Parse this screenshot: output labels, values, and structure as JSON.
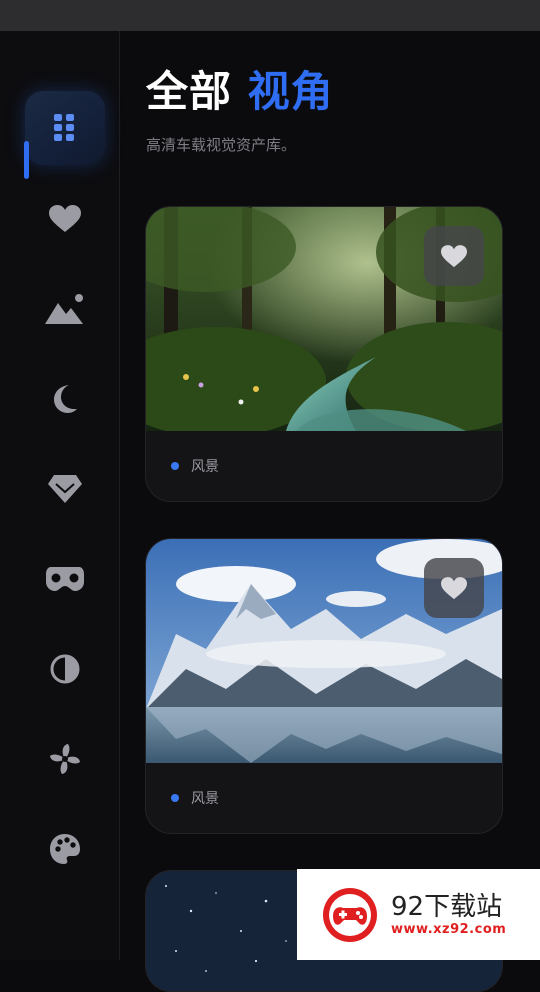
{
  "header": {
    "title_main": "全部",
    "title_accent": "视角",
    "subtitle": "高清车载视觉资产库。"
  },
  "sidebar": {
    "items": [
      {
        "icon": "grid-icon",
        "active": true
      },
      {
        "icon": "heart-icon",
        "active": false
      },
      {
        "icon": "landscape-icon",
        "active": false
      },
      {
        "icon": "moon-icon",
        "active": false
      },
      {
        "icon": "gem-icon",
        "active": false
      },
      {
        "icon": "vr-mask-icon",
        "active": false
      },
      {
        "icon": "contrast-icon",
        "active": false
      },
      {
        "icon": "fan-icon",
        "active": false
      },
      {
        "icon": "palette-icon",
        "active": false
      }
    ]
  },
  "cards": [
    {
      "category": "风景",
      "image": "forest-stream-photo",
      "favorite_icon": "heart-icon"
    },
    {
      "category": "风景",
      "image": "snow-mountain-lake-photo",
      "favorite_icon": "heart-icon"
    },
    {
      "category": "",
      "image": "starry-sky-photo"
    }
  ],
  "watermark": {
    "name": "92下载站",
    "url": "www.xz92.com"
  },
  "colors": {
    "accent": "#2f6df2",
    "background": "#0b0b0d",
    "sidebar_icon": "#9b9ba3",
    "tag_dot": "#3a78f2"
  }
}
